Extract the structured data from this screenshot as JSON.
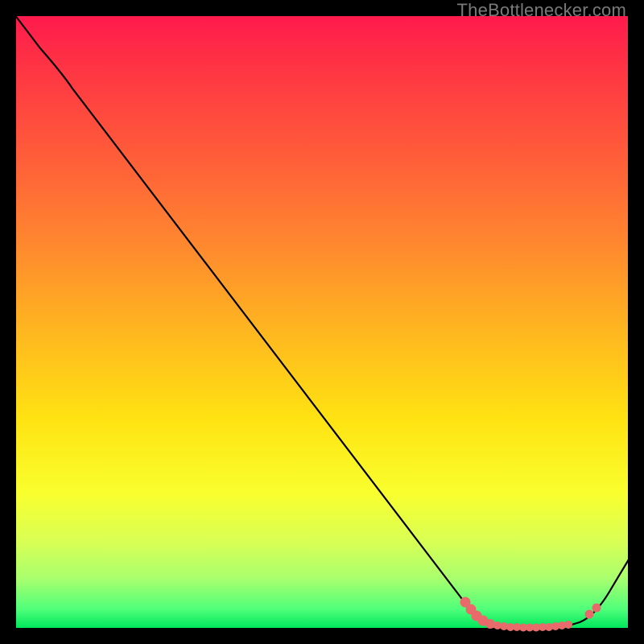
{
  "watermark": "TheBottlenecker.com",
  "colors": {
    "gradient_top": "#ff1a4d",
    "gradient_bottom": "#00e65c",
    "line": "#000000",
    "dots": "#e86a6a",
    "frame": "#000000"
  },
  "chart_data": {
    "type": "line",
    "title": "",
    "xlabel": "",
    "ylabel": "",
    "xlim": [
      0,
      100
    ],
    "ylim": [
      0,
      100
    ],
    "x": [
      0,
      8,
      75,
      80,
      90,
      100
    ],
    "y": [
      100,
      92,
      4,
      0,
      0,
      12
    ],
    "highlight_region_x": [
      74,
      95
    ],
    "annotations": []
  }
}
